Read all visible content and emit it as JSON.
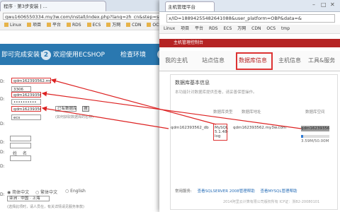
{
  "back_window": {
    "tab_title": "程序 · 第3步安装 | ...",
    "url": "qwu1606550334.my3w.com/install/index.php?lang=zh_cn&step=setting",
    "bookmarks": [
      "Linux",
      "项目",
      "平台",
      "RDS",
      "ECS",
      "万网",
      "CDN",
      "OCS",
      "tmp"
    ],
    "steps": [
      {
        "num": "",
        "label": "即可完成安装！"
      },
      {
        "num": "2",
        "label": "欢迎使用ECSHOP"
      },
      {
        "num": "",
        "label": "检查环境"
      },
      {
        "num": "3",
        "label": ""
      }
    ],
    "fields": {
      "host": "qdm162393562.my3w.com",
      "port": "3306",
      "user": "qdm162393562",
      "password": "••••••••••",
      "dbname": "qdm162393562_db",
      "prefix": "ecs_",
      "db_select": "已有数据库",
      "db_button": "搜",
      "db_hint": "(如何获取数据库的名称)"
    },
    "left_labels": [
      "D:",
      "D:",
      "D:",
      "D:",
      "D:",
      "D:",
      "D:"
    ],
    "lang_options": {
      "simplified": "简体中文",
      "traditional": "繁体中文",
      "english": "English"
    },
    "timezone": "亚洲 · 中国 · 上海",
    "admin_labels": [
      "姓",
      "名"
    ],
    "bottom_note": "(选择此项时，请人员在，有关详情请见服务条款)"
  },
  "front_window": {
    "tab_title": "主机管理平台",
    "url": "x/ID=18894255482641088&user_platform=OBP&data=&",
    "bookmarks": [
      "Linux",
      "项目",
      "平台",
      "RDS",
      "ECS",
      "万网",
      "CDN",
      "OCS",
      "tmp"
    ],
    "header": "主机管理控制台",
    "nav": [
      {
        "label": "我的主机",
        "active": false
      },
      {
        "label": "站点信息",
        "active": false
      },
      {
        "label": "数据库信息",
        "active": true
      },
      {
        "label": "主机信息",
        "active": false
      },
      {
        "label": "工具&服务",
        "active": false
      }
    ],
    "panel_title": "数据库基本信息",
    "panel_note": "本功能针对数据库提供查看，请妥善保管操作。",
    "table_headers": [
      "",
      "数据库类型",
      "数据库地址",
      "数据库空间"
    ],
    "row": {
      "name": "qdm162393562_db",
      "type": "MySQL 5.1.48-log",
      "address": "qdm162393562.my3w.com",
      "user": "qdm162393562",
      "usage": "3.59M/50.00M"
    },
    "usage_percent": 7.2,
    "links_label": "常用服务:",
    "links": [
      "查看SQLSERVER 2008管理帮助",
      "查看MYSQL管理帮助"
    ],
    "footer": "2014阿里云计算有限公司版权所有 ICP证：浙B2-20080101"
  }
}
